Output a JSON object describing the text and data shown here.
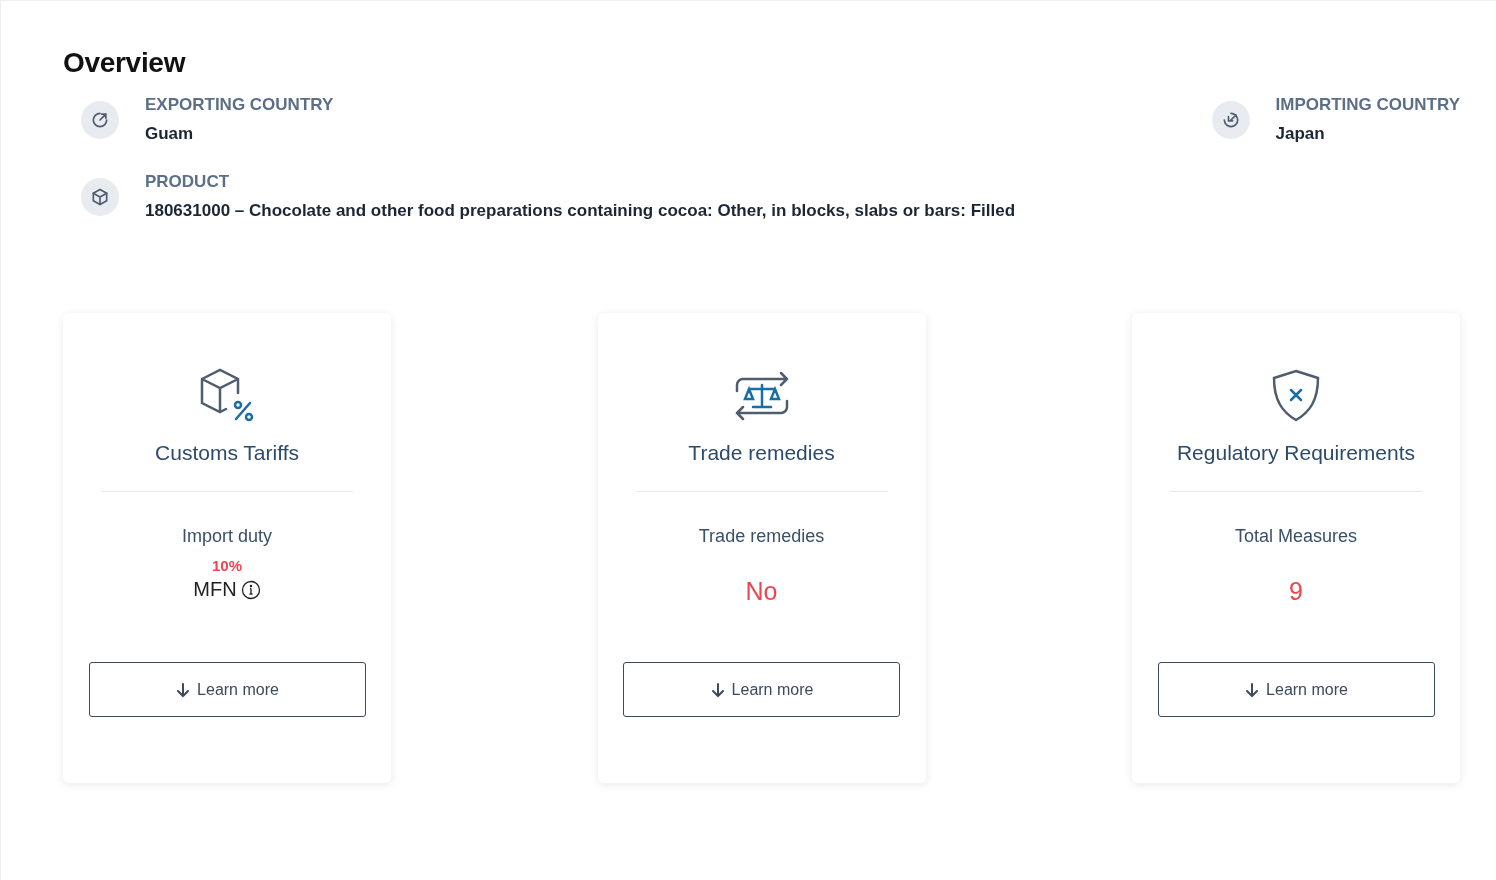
{
  "title": "Overview",
  "countries": [
    {
      "kind": "export",
      "label": "EXPORTING COUNTRY",
      "value": "Guam"
    },
    {
      "kind": "import",
      "label": "IMPORTING COUNTRY",
      "value": "Japan"
    }
  ],
  "product": {
    "kind": "product",
    "label": "PRODUCT",
    "value": "180631000 – Chocolate and other food preparations containing cocoa: Other, in blocks, slabs or bars: Filled"
  },
  "cards": [
    {
      "kind": "tariffs",
      "title": "Customs Tariffs",
      "label": "Import duty",
      "value": "10%",
      "note": "MFN",
      "button": "Learn more"
    },
    {
      "kind": "remedies",
      "title": "Trade remedies",
      "label": "Trade remedies",
      "value": "No",
      "button": "Learn more"
    },
    {
      "kind": "regulatory",
      "title": "Regulatory Requirements",
      "label": "Total Measures",
      "value": "9",
      "button": "Learn more"
    }
  ]
}
